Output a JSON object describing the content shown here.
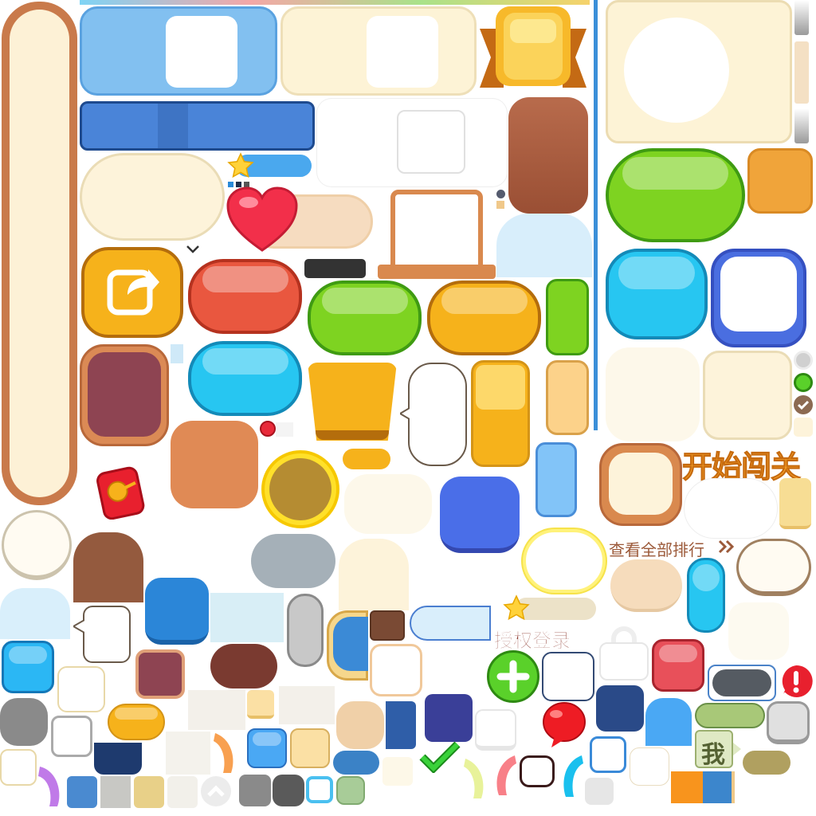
{
  "atlas": {
    "labels": {
      "start_level": "开始闯关",
      "view_all_rankings": "查看全部排行",
      "authorize_login": "授权登录",
      "me": "我"
    },
    "icons": {
      "share": "share-arrow-icon",
      "heart": "heart-icon",
      "star": "star-icon",
      "plus": "plus-icon",
      "check": "checkmark-icon",
      "alert": "exclamation-icon",
      "chevron": "double-chevron-right-icon",
      "lock": "padlock-icon",
      "ribbon": "gold-ribbon-banner-icon"
    },
    "colors": {
      "cream": "#fdf3da",
      "brown": "#c97a4b",
      "green": "#7ed321",
      "cyan": "#27c6f1",
      "orange": "#f6b21b",
      "red": "#e9573f",
      "blue": "#4a8ee0",
      "navy": "#1e3a6e"
    }
  }
}
